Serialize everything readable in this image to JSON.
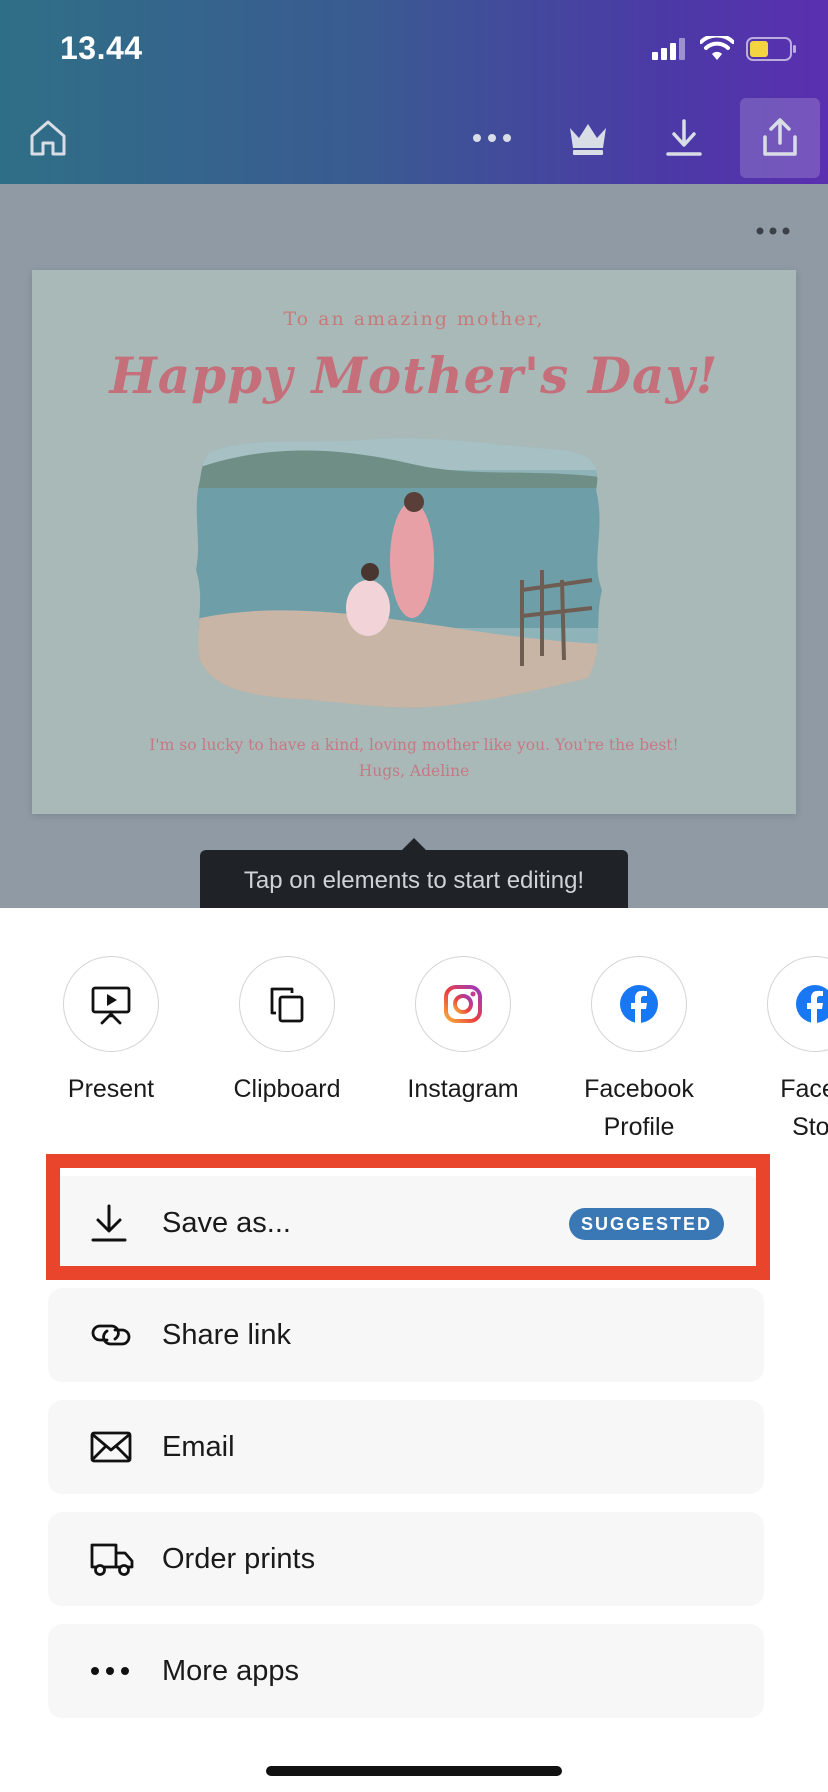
{
  "status_bar": {
    "time": "13.44"
  },
  "editor": {
    "card": {
      "subtitle": "To an amazing mother,",
      "title": "Happy Mother's Day!",
      "message_line1": "I'm so lucky to have a kind, loving mother like you. You're the best!",
      "message_line2": "Hugs, Adeline"
    },
    "tooltip": "Tap on elements to start editing!"
  },
  "share_targets": [
    {
      "label": "Present",
      "icon": "present-icon"
    },
    {
      "label": "Clipboard",
      "icon": "clipboard-icon"
    },
    {
      "label": "Instagram",
      "icon": "instagram-icon"
    },
    {
      "label": "Facebook\nProfile",
      "icon": "facebook-icon"
    },
    {
      "label": "Faceb\nStor",
      "icon": "facebook-icon"
    }
  ],
  "options": {
    "save_as": {
      "label": "Save as...",
      "badge": "SUGGESTED"
    },
    "share_link": {
      "label": "Share link"
    },
    "email": {
      "label": "Email"
    },
    "order_prints": {
      "label": "Order prints"
    },
    "more_apps": {
      "label": "More apps"
    }
  },
  "colors": {
    "highlight": "#e8452c",
    "badge": "#3a78b5"
  }
}
